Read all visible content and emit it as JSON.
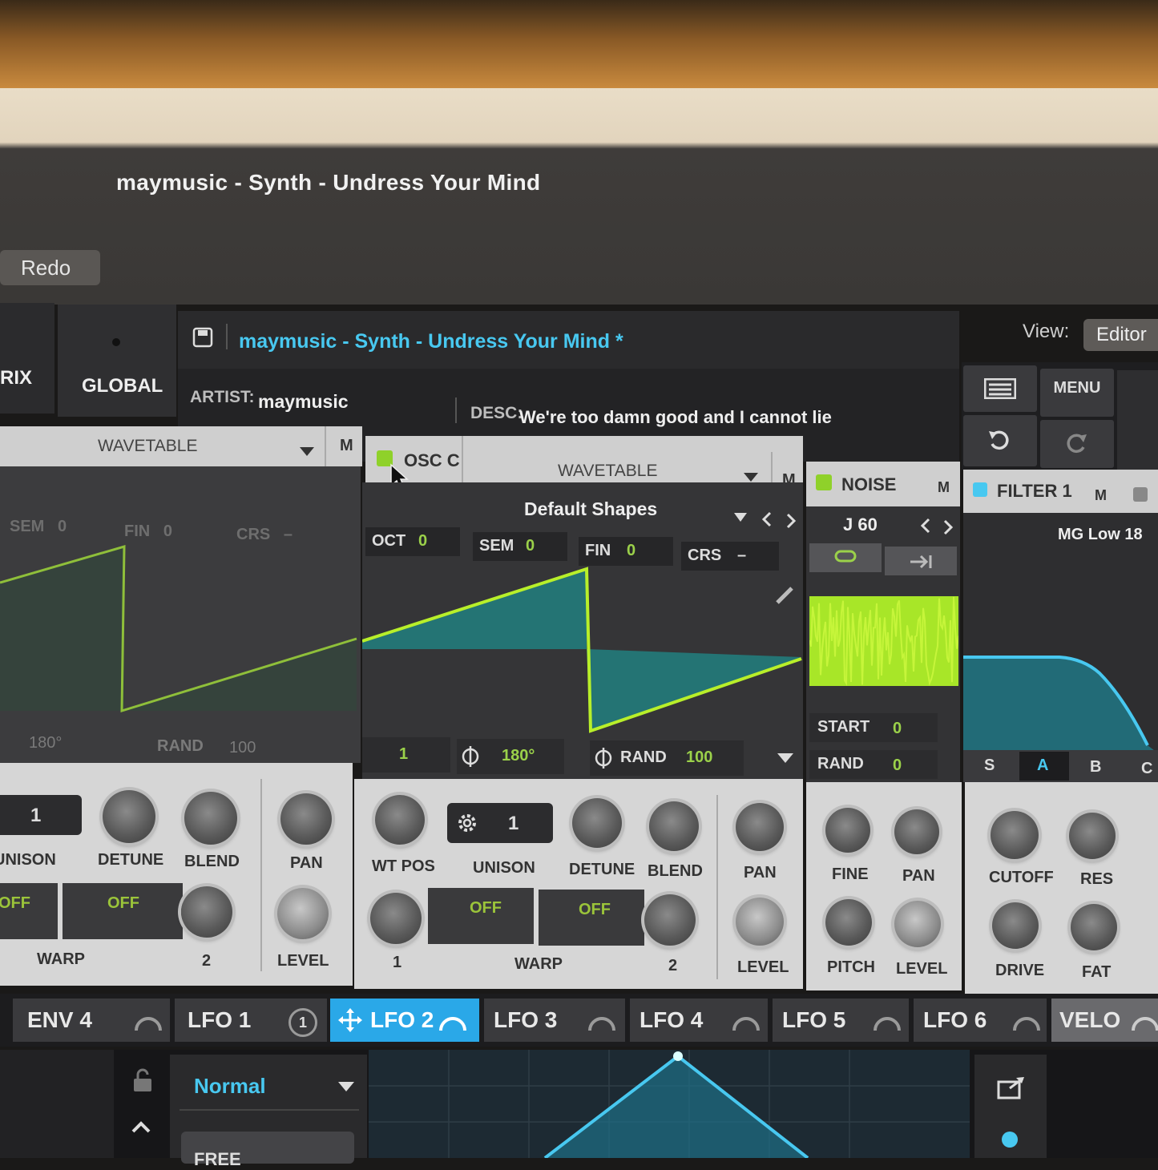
{
  "window": {
    "title": "maymusic - Synth - Undress Your Mind",
    "redo_label": "Redo",
    "view_label": "View:",
    "view_value": "Editor"
  },
  "header": {
    "tab_partial": "RIX",
    "tab_global": "GLOBAL",
    "preset_name": "maymusic - Synth - Undress Your Mind *",
    "artist_label": "ARTIST:",
    "artist_value": "maymusic",
    "desc_label": "DESC:",
    "desc_value": "We're too damn good and I cannot lie",
    "menu_label": "MENU"
  },
  "osc_b": {
    "type": "WAVETABLE",
    "mute": "M",
    "sem_label": "SEM",
    "sem_value": "0",
    "fin_label": "FIN",
    "fin_value": "0",
    "crs_label": "CRS",
    "crs_value": "–",
    "phase": "180°",
    "rand_label": "RAND",
    "rand_value": "100",
    "unison_value": "1",
    "knobs": [
      "UNISON",
      "DETUNE",
      "BLEND",
      "PAN",
      "LEVEL"
    ],
    "warp_label": "WARP",
    "warp_a": "OFF",
    "warp_b": "OFF",
    "warp_num": "2"
  },
  "osc_c": {
    "title": "OSC C",
    "type": "WAVETABLE",
    "mute": "M",
    "table": "Default Shapes",
    "oct_label": "OCT",
    "oct_value": "0",
    "sem_label": "SEM",
    "sem_value": "0",
    "fin_label": "FIN",
    "fin_value": "0",
    "crs_label": "CRS",
    "crs_value": "–",
    "frame": "1",
    "phase": "180°",
    "rand_label": "RAND",
    "rand_value": "100",
    "unison_value": "1",
    "knobs": {
      "wtpos": "WT POS",
      "unison": "UNISON",
      "detune": "DETUNE",
      "blend": "BLEND",
      "pan": "PAN",
      "level": "LEVEL"
    },
    "warp_label": "WARP",
    "warp_a": "OFF",
    "warp_b": "OFF",
    "warp_1": "1",
    "warp_2": "2"
  },
  "noise": {
    "title": "NOISE",
    "mute": "M",
    "sample": "J 60",
    "start_label": "START",
    "start_value": "0",
    "rand_label": "RAND",
    "rand_value": "0",
    "knobs": {
      "fine": "FINE",
      "pan": "PAN",
      "pitch": "PITCH",
      "level": "LEVEL"
    }
  },
  "filter": {
    "title": "FILTER 1",
    "mute": "M",
    "type": "MG Low 18",
    "routes": [
      "S",
      "A",
      "B",
      "C"
    ],
    "knobs": {
      "cutoff": "CUTOFF",
      "res": "RES",
      "drive": "DRIVE",
      "fat": "FAT"
    }
  },
  "mod_tabs": [
    "ENV 4",
    "LFO 1",
    "LFO 2",
    "LFO 3",
    "LFO 4",
    "LFO 5",
    "LFO 6",
    "VELO"
  ],
  "lfo1_badge": "1",
  "lfo": {
    "mode": "Normal",
    "trig": "FREE"
  },
  "colors": {
    "accent": "#48c8f0",
    "wave": "#b8ef2a",
    "panel_light": "#d6d6d6",
    "panel_dark": "#2a2a2c"
  }
}
